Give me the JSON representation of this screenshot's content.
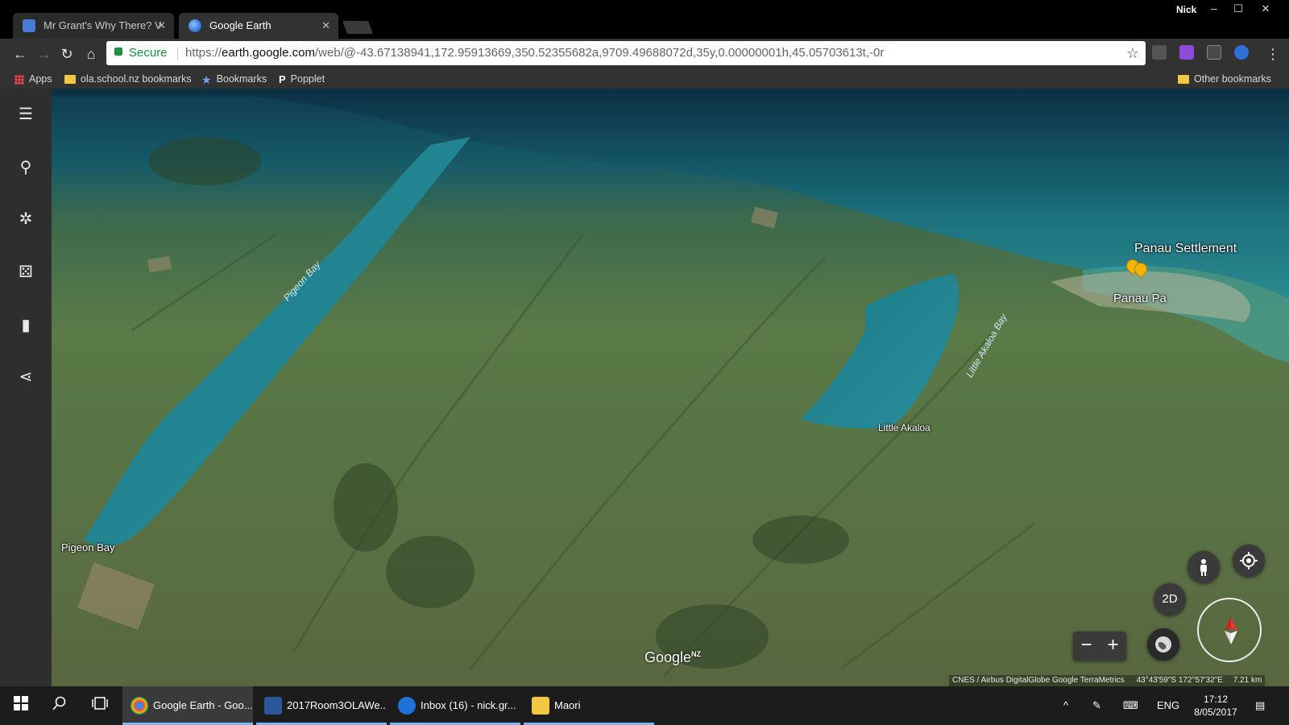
{
  "browser": {
    "profile": "Nick",
    "window_buttons": [
      "–",
      "☐",
      "✕"
    ],
    "tabs": [
      {
        "title": "Mr Grant's Why There? V",
        "active": false
      },
      {
        "title": "Google Earth",
        "active": true
      }
    ],
    "tab_close": "✕",
    "secure_label": "Secure",
    "url_scheme": "https://",
    "url_host": "earth.google.com",
    "url_path": "/web/@-43.67138941,172.95913669,350.52355682a,9709.49688072d,35y,0.00000001h,45.05703613t,-0r",
    "star": "☆",
    "menu": "⋮",
    "nav": {
      "back": "←",
      "forward": "→",
      "reload": "↻",
      "home": "⌂"
    },
    "bookmarks": [
      {
        "label": "Apps",
        "icon": "apps-grid-icon"
      },
      {
        "label": "ola.school.nz bookmarks",
        "icon": "folder-icon"
      },
      {
        "label": "Bookmarks",
        "icon": "star-icon"
      },
      {
        "label": "Popplet",
        "icon": "popplet-icon"
      }
    ],
    "other_bookmarks": "Other bookmarks"
  },
  "earth": {
    "rail": [
      {
        "icon": "menu-icon",
        "glyph": "☰"
      },
      {
        "icon": "search-icon",
        "glyph": "⚲"
      },
      {
        "icon": "voyager-icon",
        "glyph": "✲"
      },
      {
        "icon": "feeling-lucky-dice-icon",
        "glyph": "⚄"
      },
      {
        "icon": "bookmark-icon",
        "glyph": "▮"
      },
      {
        "icon": "share-icon",
        "glyph": "⋖"
      }
    ],
    "labels": {
      "panau_settlement": "Panau Settlement",
      "panau_pa": "Panau Pa",
      "little_akaloa": "Little Akaloa",
      "pigeon_bay": "Pigeon Bay",
      "pigeon_bay_water": "Pigeon Bay",
      "little_akaloa_bay_water": "Little Akaloa Bay"
    },
    "controls": {
      "pegman": "pegman-icon",
      "my_location": "my-location-icon",
      "mode_2d": "2D",
      "zoom_out": "−",
      "zoom_in": "+"
    },
    "logo": "Google",
    "logo_region": "NZ",
    "attribution": "CNES / Airbus  DigitalGlobe  Google  TerraMetrics",
    "coordinates": "43°43'59\"S 172°57'32\"E",
    "scale": "7.21 km"
  },
  "taskbar": {
    "items": [
      {
        "label": "Google Earth - Goo...",
        "icon": "chrome-icon",
        "color": "#4285f4",
        "state": "active"
      },
      {
        "label": "2017Room3OLAWe...",
        "icon": "word-icon",
        "color": "#2b579a",
        "state": "open"
      },
      {
        "label": "Inbox (16) - nick.gr...",
        "icon": "edge-icon",
        "color": "#1e73d8",
        "state": "open"
      },
      {
        "label": "Maori",
        "icon": "file-explorer-icon",
        "color": "#f2c744",
        "state": "open"
      }
    ],
    "language": "ENG",
    "time": "17:12",
    "date": "8/05/2017"
  }
}
